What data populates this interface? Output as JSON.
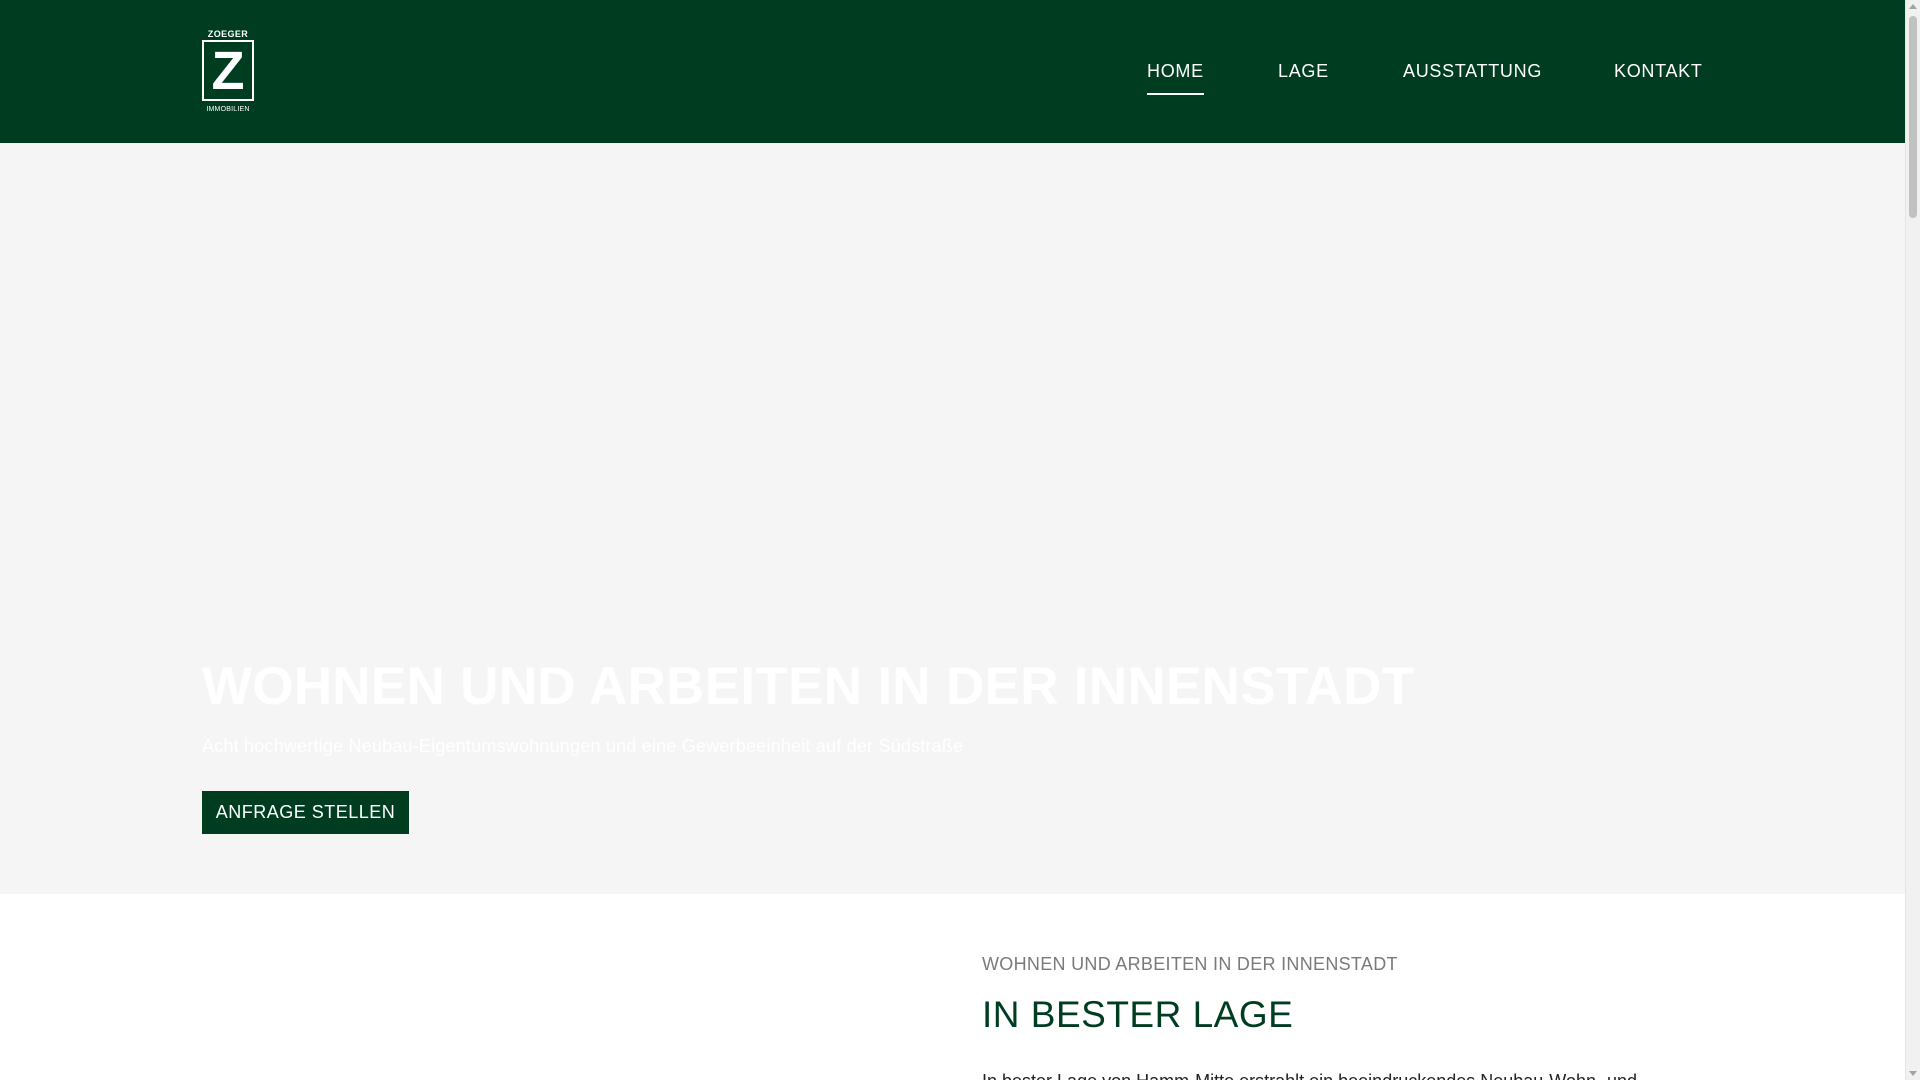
{
  "colors": {
    "brand_green": "#003d20",
    "hero_background": "#f5f5f5",
    "text_white": "#ffffff",
    "eyebrow_gray": "#7a7a7a"
  },
  "logo": {
    "top_text": "ZOEGER",
    "letter": "Z",
    "bottom_text": "IMMOBILIEN"
  },
  "nav": {
    "items": [
      {
        "label": "HOME",
        "active": true
      },
      {
        "label": "LAGE",
        "active": false
      },
      {
        "label": "AUSSTATTUNG",
        "active": false
      },
      {
        "label": "KONTAKT",
        "active": false
      }
    ]
  },
  "hero": {
    "title": "WOHNEN UND ARBEITEN IN DER INNENSTADT",
    "subtitle": "Acht hochwertige Neubau-Eigentumswohnungen und eine Gewerbeeinheit auf der Südstraße",
    "button_label": "ANFRAGE STELLEN"
  },
  "content": {
    "eyebrow": "WOHNEN UND ARBEITEN IN DER INNENSTADT",
    "heading": "IN BESTER LAGE",
    "paragraph": "In bester Lage von Hamm-Mitte erstrahlt ein beeindruckendes Neubau-Wohn- und"
  },
  "scrollbar": {
    "icons": [
      "scroll-up-arrow-icon",
      "scroll-down-arrow-icon"
    ]
  }
}
